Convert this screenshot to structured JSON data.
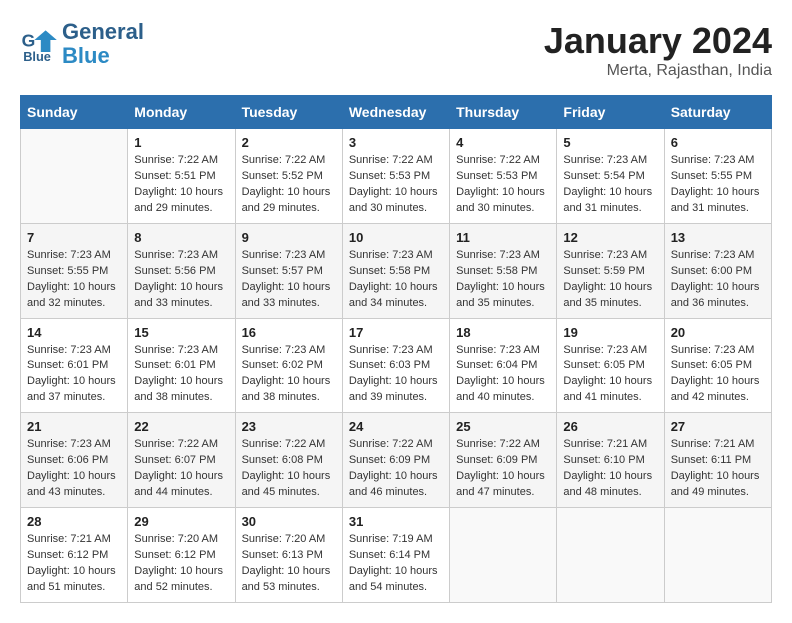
{
  "header": {
    "logo_line1": "General",
    "logo_line2": "Blue",
    "month_year": "January 2024",
    "location": "Merta, Rajasthan, India"
  },
  "weekdays": [
    "Sunday",
    "Monday",
    "Tuesday",
    "Wednesday",
    "Thursday",
    "Friday",
    "Saturday"
  ],
  "weeks": [
    [
      {
        "day": "",
        "info": ""
      },
      {
        "day": "1",
        "info": "Sunrise: 7:22 AM\nSunset: 5:51 PM\nDaylight: 10 hours\nand 29 minutes."
      },
      {
        "day": "2",
        "info": "Sunrise: 7:22 AM\nSunset: 5:52 PM\nDaylight: 10 hours\nand 29 minutes."
      },
      {
        "day": "3",
        "info": "Sunrise: 7:22 AM\nSunset: 5:53 PM\nDaylight: 10 hours\nand 30 minutes."
      },
      {
        "day": "4",
        "info": "Sunrise: 7:22 AM\nSunset: 5:53 PM\nDaylight: 10 hours\nand 30 minutes."
      },
      {
        "day": "5",
        "info": "Sunrise: 7:23 AM\nSunset: 5:54 PM\nDaylight: 10 hours\nand 31 minutes."
      },
      {
        "day": "6",
        "info": "Sunrise: 7:23 AM\nSunset: 5:55 PM\nDaylight: 10 hours\nand 31 minutes."
      }
    ],
    [
      {
        "day": "7",
        "info": "Sunrise: 7:23 AM\nSunset: 5:55 PM\nDaylight: 10 hours\nand 32 minutes."
      },
      {
        "day": "8",
        "info": "Sunrise: 7:23 AM\nSunset: 5:56 PM\nDaylight: 10 hours\nand 33 minutes."
      },
      {
        "day": "9",
        "info": "Sunrise: 7:23 AM\nSunset: 5:57 PM\nDaylight: 10 hours\nand 33 minutes."
      },
      {
        "day": "10",
        "info": "Sunrise: 7:23 AM\nSunset: 5:58 PM\nDaylight: 10 hours\nand 34 minutes."
      },
      {
        "day": "11",
        "info": "Sunrise: 7:23 AM\nSunset: 5:58 PM\nDaylight: 10 hours\nand 35 minutes."
      },
      {
        "day": "12",
        "info": "Sunrise: 7:23 AM\nSunset: 5:59 PM\nDaylight: 10 hours\nand 35 minutes."
      },
      {
        "day": "13",
        "info": "Sunrise: 7:23 AM\nSunset: 6:00 PM\nDaylight: 10 hours\nand 36 minutes."
      }
    ],
    [
      {
        "day": "14",
        "info": "Sunrise: 7:23 AM\nSunset: 6:01 PM\nDaylight: 10 hours\nand 37 minutes."
      },
      {
        "day": "15",
        "info": "Sunrise: 7:23 AM\nSunset: 6:01 PM\nDaylight: 10 hours\nand 38 minutes."
      },
      {
        "day": "16",
        "info": "Sunrise: 7:23 AM\nSunset: 6:02 PM\nDaylight: 10 hours\nand 38 minutes."
      },
      {
        "day": "17",
        "info": "Sunrise: 7:23 AM\nSunset: 6:03 PM\nDaylight: 10 hours\nand 39 minutes."
      },
      {
        "day": "18",
        "info": "Sunrise: 7:23 AM\nSunset: 6:04 PM\nDaylight: 10 hours\nand 40 minutes."
      },
      {
        "day": "19",
        "info": "Sunrise: 7:23 AM\nSunset: 6:05 PM\nDaylight: 10 hours\nand 41 minutes."
      },
      {
        "day": "20",
        "info": "Sunrise: 7:23 AM\nSunset: 6:05 PM\nDaylight: 10 hours\nand 42 minutes."
      }
    ],
    [
      {
        "day": "21",
        "info": "Sunrise: 7:23 AM\nSunset: 6:06 PM\nDaylight: 10 hours\nand 43 minutes."
      },
      {
        "day": "22",
        "info": "Sunrise: 7:22 AM\nSunset: 6:07 PM\nDaylight: 10 hours\nand 44 minutes."
      },
      {
        "day": "23",
        "info": "Sunrise: 7:22 AM\nSunset: 6:08 PM\nDaylight: 10 hours\nand 45 minutes."
      },
      {
        "day": "24",
        "info": "Sunrise: 7:22 AM\nSunset: 6:09 PM\nDaylight: 10 hours\nand 46 minutes."
      },
      {
        "day": "25",
        "info": "Sunrise: 7:22 AM\nSunset: 6:09 PM\nDaylight: 10 hours\nand 47 minutes."
      },
      {
        "day": "26",
        "info": "Sunrise: 7:21 AM\nSunset: 6:10 PM\nDaylight: 10 hours\nand 48 minutes."
      },
      {
        "day": "27",
        "info": "Sunrise: 7:21 AM\nSunset: 6:11 PM\nDaylight: 10 hours\nand 49 minutes."
      }
    ],
    [
      {
        "day": "28",
        "info": "Sunrise: 7:21 AM\nSunset: 6:12 PM\nDaylight: 10 hours\nand 51 minutes."
      },
      {
        "day": "29",
        "info": "Sunrise: 7:20 AM\nSunset: 6:12 PM\nDaylight: 10 hours\nand 52 minutes."
      },
      {
        "day": "30",
        "info": "Sunrise: 7:20 AM\nSunset: 6:13 PM\nDaylight: 10 hours\nand 53 minutes."
      },
      {
        "day": "31",
        "info": "Sunrise: 7:19 AM\nSunset: 6:14 PM\nDaylight: 10 hours\nand 54 minutes."
      },
      {
        "day": "",
        "info": ""
      },
      {
        "day": "",
        "info": ""
      },
      {
        "day": "",
        "info": ""
      }
    ]
  ]
}
